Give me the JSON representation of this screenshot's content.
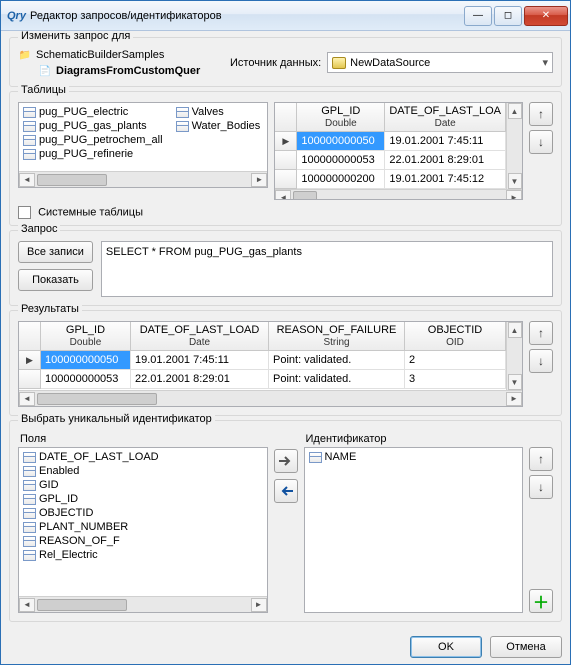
{
  "window": {
    "title": "Редактор запросов/идентификаторов",
    "icon_label": "Qry"
  },
  "change_for": {
    "legend": "Изменить запрос для",
    "root": "SchematicBuilderSamples",
    "child": "DiagramsFromCustomQuer",
    "ds_label": "Источник данных:",
    "ds_value": "NewDataSource"
  },
  "tables": {
    "legend": "Таблицы",
    "system_tables_label": "Системные таблицы",
    "list": [
      "pug_PUG_electric",
      "pug_PUG_gas_plants",
      "pug_PUG_petrochem_all",
      "pug_PUG_refinerie",
      "Valves",
      "Water_Bodies"
    ],
    "preview": {
      "cols": [
        {
          "name": "GPL_ID",
          "type": "Double"
        },
        {
          "name": "DATE_OF_LAST_LOA",
          "type": "Date"
        }
      ],
      "rows": [
        {
          "gpl_id": "100000000050",
          "date": "19.01.2001 7:45:11",
          "current": true
        },
        {
          "gpl_id": "100000000053",
          "date": "22.01.2001 8:29:01"
        },
        {
          "gpl_id": "100000000200",
          "date": "19.01.2001 7:45:12"
        }
      ]
    }
  },
  "query": {
    "legend": "Запрос",
    "btn_all": "Все записи",
    "btn_show": "Показать",
    "sql": "SELECT * FROM pug_PUG_gas_plants"
  },
  "results": {
    "legend": "Результаты",
    "cols": [
      {
        "name": "GPL_ID",
        "type": "Double"
      },
      {
        "name": "DATE_OF_LAST_LOAD",
        "type": "Date"
      },
      {
        "name": "REASON_OF_FAILURE",
        "type": "String"
      },
      {
        "name": "OBJECTID",
        "type": "OID"
      }
    ],
    "rows": [
      {
        "gpl_id": "100000000050",
        "date": "19.01.2001 7:45:11",
        "reason": "Point: validated.",
        "objectid": "2",
        "current": true
      },
      {
        "gpl_id": "100000000053",
        "date": "22.01.2001 8:29:01",
        "reason": "Point: validated.",
        "objectid": "3"
      }
    ]
  },
  "identifier": {
    "legend": "Выбрать уникальный идентификатор",
    "fields_label": "Поля",
    "ident_label": "Идентификатор",
    "fields": [
      "DATE_OF_LAST_LOAD",
      "Enabled",
      "GID",
      "GPL_ID",
      "OBJECTID",
      "PLANT_NUMBER",
      "REASON_OF_F",
      "Rel_Electric"
    ],
    "chosen": [
      "NAME"
    ]
  },
  "footer": {
    "ok": "OK",
    "cancel": "Отмена"
  }
}
